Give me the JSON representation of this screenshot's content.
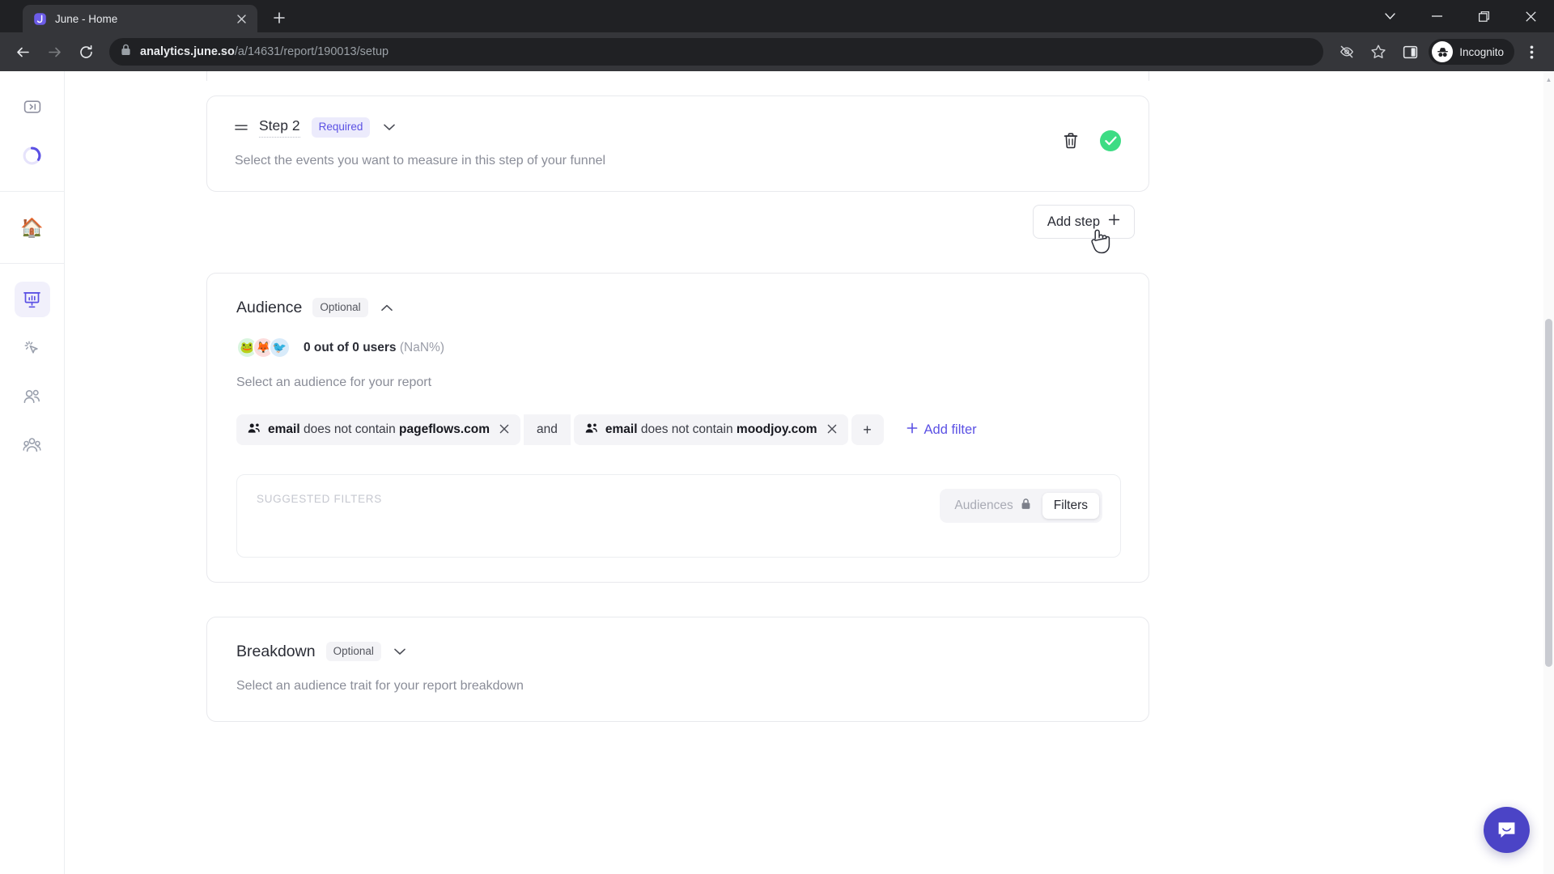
{
  "browser": {
    "tab": {
      "title": "June - Home",
      "favicon_icon": "june-logo-icon",
      "close_icon": "close-icon"
    },
    "new_tab_icon": "plus-icon",
    "window_controls": [
      {
        "name": "tab-search",
        "glyph": "⌄"
      },
      {
        "name": "minimize",
        "glyph": "—"
      },
      {
        "name": "maximize",
        "glyph": "❐"
      },
      {
        "name": "close",
        "glyph": "✕"
      }
    ],
    "nav": {
      "back_icon": "back-arrow-icon",
      "forward_icon": "forward-arrow-icon",
      "reload_icon": "reload-icon"
    },
    "omnibox": {
      "lock_icon": "lock-icon",
      "url_domain": "analytics.june.so",
      "url_path": "/a/14631/report/190013/setup"
    },
    "toolbar_right": {
      "tracking_protection_icon": "eye-slash-icon",
      "bookmark_icon": "star-icon",
      "side_panel_icon": "side-panel-icon",
      "incognito_label": "Incognito",
      "incognito_icon": "incognito-hat-icon",
      "menu_icon": "three-dot-menu-icon"
    }
  },
  "sidebar": {
    "items": [
      {
        "name": "expand-panel",
        "icon": "expand-panel-icon",
        "active": false
      },
      {
        "name": "loading-spinner",
        "icon": "loading-spinner-icon",
        "active": false
      },
      {
        "name": "home",
        "icon": "house-emoji",
        "emoji": "🏠",
        "active": false
      },
      {
        "name": "reports",
        "icon": "report-board-icon",
        "active": true
      },
      {
        "name": "events",
        "icon": "click-cursor-icon",
        "active": false
      },
      {
        "name": "users",
        "icon": "users-icon",
        "active": false
      },
      {
        "name": "groups",
        "icon": "groups-icon",
        "active": false
      }
    ]
  },
  "step": {
    "drag_handle_icon": "drag-handle-icon",
    "name": "Step 2",
    "badge": "Required",
    "chevron_icon": "chevron-down-icon",
    "description": "Select the events you want to measure in this step of your funnel",
    "delete_icon": "trash-icon",
    "status_icon": "check-circle-icon"
  },
  "add_step": {
    "label": "Add step",
    "plus_icon": "plus-icon",
    "cursor_icon": "pointer-hand-cursor"
  },
  "audience": {
    "title": "Audience",
    "badge": "Optional",
    "chevron_icon": "chevron-up-icon",
    "count_bold": "0 out of 0 users",
    "count_muted": "(NaN%)",
    "avatars": [
      {
        "emoji": "🐸",
        "bg": "#d9f5df"
      },
      {
        "emoji": "🦊",
        "bg": "#fcdcdc"
      },
      {
        "emoji": "🐦",
        "bg": "#d8ebfa"
      }
    ],
    "description": "Select an audience for your report",
    "filters": [
      {
        "icon": "people-filter-icon",
        "field": "email",
        "operator": "does not contain",
        "value": "pageflows.com",
        "remove_icon": "close-icon"
      },
      {
        "icon": "people-filter-icon",
        "field": "email",
        "operator": "does not contain",
        "value": "moodjoy.com",
        "remove_icon": "close-icon"
      }
    ],
    "join_word": "and",
    "chip_add_label": "+",
    "add_filter_label": "Add filter",
    "add_filter_plus": "+",
    "suggested": {
      "label": "SUGGESTED FILTERS",
      "toggle": {
        "audiences_label": "Audiences",
        "audiences_lock_icon": "lock-icon",
        "filters_label": "Filters",
        "active": "Filters"
      }
    }
  },
  "breakdown": {
    "title": "Breakdown",
    "badge": "Optional",
    "chevron_icon": "chevron-down-icon",
    "description": "Select an audience trait for your report breakdown"
  },
  "intercom": {
    "icon": "intercom-chat-icon"
  },
  "colors": {
    "accent_purple": "#5b51e4",
    "badge_required_bg": "#ecebfc",
    "success_green": "#3ddc84",
    "intercom_purple": "#4b44c6"
  }
}
